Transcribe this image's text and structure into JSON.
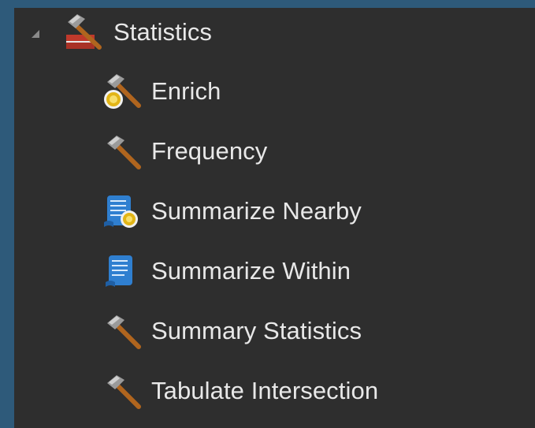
{
  "tree": {
    "group": {
      "label": "Statistics",
      "icon": "toolbox-icon",
      "expanded": true
    },
    "items": [
      {
        "label": "Enrich",
        "icon": "hammer-globe-icon"
      },
      {
        "label": "Frequency",
        "icon": "hammer-icon"
      },
      {
        "label": "Summarize Nearby",
        "icon": "script-globe-icon"
      },
      {
        "label": "Summarize Within",
        "icon": "script-icon"
      },
      {
        "label": "Summary Statistics",
        "icon": "hammer-icon"
      },
      {
        "label": "Tabulate Intersection",
        "icon": "hammer-icon"
      }
    ]
  }
}
